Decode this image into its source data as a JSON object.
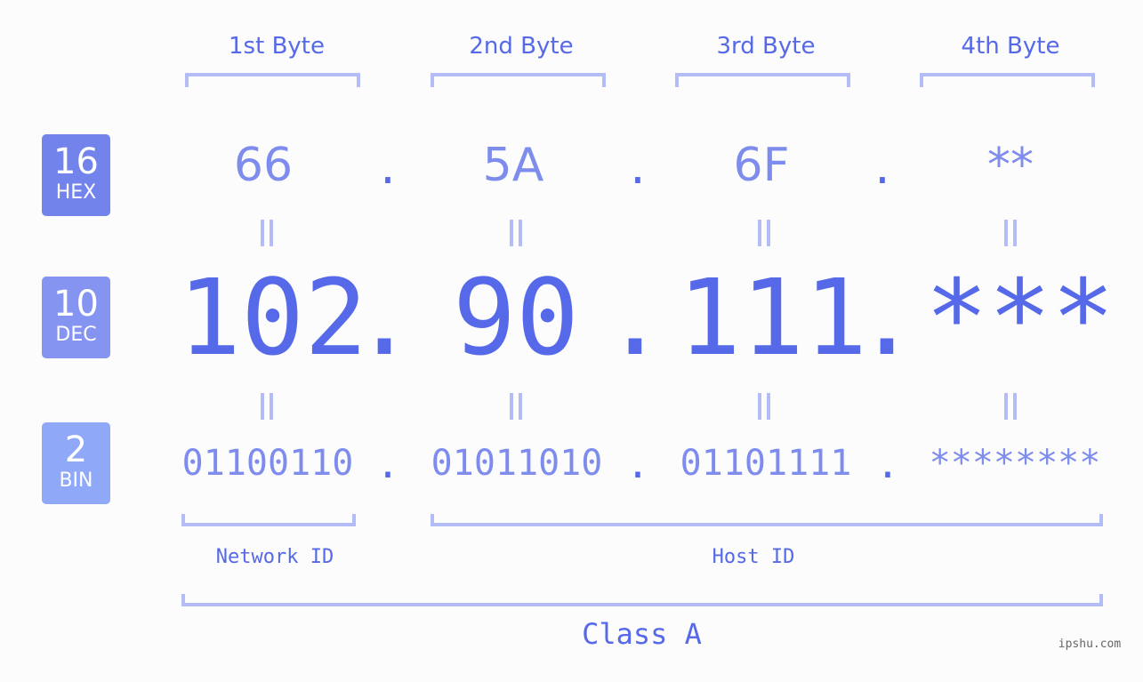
{
  "colors": {
    "hex_badge": "#7383ec",
    "dec_badge": "#8594f1",
    "bin_badge": "#8fa8f8",
    "primary_text": "#5669e8",
    "secondary_text": "#7d8ced",
    "bracket": "#b3bcf7"
  },
  "badges": {
    "hex": {
      "number": "16",
      "label": "HEX"
    },
    "dec": {
      "number": "10",
      "label": "DEC"
    },
    "bin": {
      "number": "2",
      "label": "BIN"
    }
  },
  "byte_headers": [
    "1st Byte",
    "2nd Byte",
    "3rd Byte",
    "4th Byte"
  ],
  "separator": ".",
  "equals_sign": "||",
  "hex_values": [
    "66",
    "5A",
    "6F",
    "**"
  ],
  "dec_values": [
    "102",
    "90",
    "111",
    "***"
  ],
  "bin_values": [
    "01100110",
    "01011010",
    "01101111",
    "********"
  ],
  "segments": {
    "network_id": "Network ID",
    "host_id": "Host ID"
  },
  "class_label": "Class A",
  "watermark": "ipshu.com"
}
